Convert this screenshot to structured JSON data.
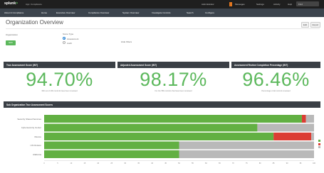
{
  "topbar": {
    "logo_prefix": "splunk",
    "logo_suffix": ">",
    "app_label": "App: Compliance",
    "user_label": "Administrator",
    "messages_label": "Messages",
    "settings_label": "Settings",
    "activity_label": "Activity",
    "help_label": "Help",
    "find_label": "Find"
  },
  "nav": {
    "items": [
      "About & Compliance",
      "Home",
      "Executive Overview",
      "Compliance Overview",
      "System Overview",
      "Investigate Controls",
      "Search",
      "Configure"
    ]
  },
  "dashboard": {
    "title": "Organization Overview",
    "edit_label": "Edit",
    "more_label": "Export"
  },
  "filters": {
    "organization_label": "Organization",
    "submit_label": "Edit",
    "score_type_label": "Score Type",
    "options": [
      "Assessment",
      "Audit"
    ],
    "selected": "Assessment",
    "hide_filters_label": "Hide Filters"
  },
  "kpis": [
    {
      "title": "True Assessment Score (INT)",
      "value": "94.70%",
      "subtitle": "390 out of 400 controls have been reviewed"
    },
    {
      "title": "Adjusted Assessment Score (INT)",
      "value": "98.17%",
      "subtitle": "For the 580 controls that have been reviewed"
    },
    {
      "title": "Assessment Review Completion Percentage (INT)",
      "value": "96.46%",
      "subtitle": "Percentage of all controls reviewed"
    }
  ],
  "colors": {
    "green": "#62b043",
    "gray": "#b9b9b9",
    "red": "#db3d34",
    "panel_dark": "#3a3f45",
    "nav_bg": "#3c444d"
  },
  "chart_data": {
    "type": "bar",
    "orientation": "horizontal",
    "stacked": true,
    "title": "Sub Organization True Assessment Scores",
    "categories": [
      "Security Shared Services",
      "Cybersecurity Center",
      "Mexico",
      "US Division",
      "Alabama"
    ],
    "series": [
      {
        "name": "",
        "color": "#62b043",
        "values": [
          95.5,
          79,
          85,
          50,
          50
        ]
      },
      {
        "name": "",
        "color": "#db3d34",
        "values": [
          1.5,
          0,
          14,
          0,
          0
        ]
      },
      {
        "name": "",
        "color": "#b9b9b9",
        "values": [
          3,
          21,
          1,
          50,
          50
        ]
      }
    ],
    "xlim": [
      0,
      100
    ],
    "xticks": [
      "0",
      "5",
      "10",
      "15",
      "20",
      "25",
      "30",
      "35",
      "40",
      "45",
      "50",
      "55",
      "60",
      "65",
      "70",
      "75",
      "80",
      "85",
      "90",
      "95",
      "100"
    ],
    "grid": false,
    "legend": "right"
  }
}
